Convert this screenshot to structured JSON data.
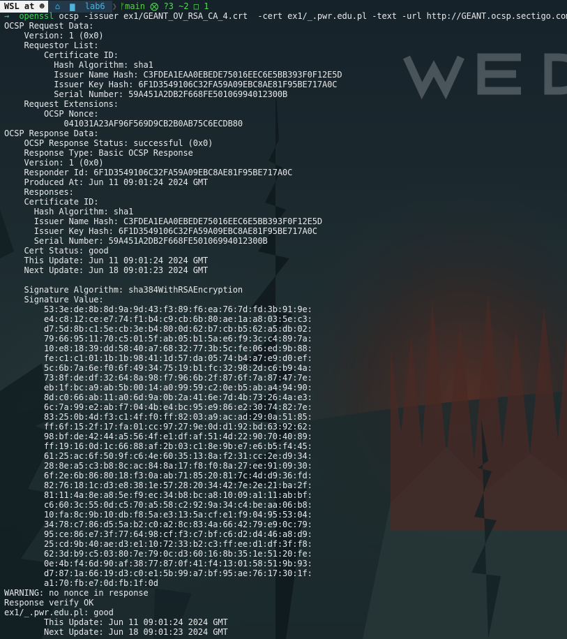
{
  "prompt": {
    "host": "WSL at",
    "host_icon": "os-logo-icon",
    "home_icon": "home-icon",
    "folder_icon": "folder-icon",
    "directory": "lab6",
    "branch_icon": "git-branch-icon",
    "branch": "main",
    "git_status": "⨂ ?3 ~2 □ 1",
    "separator": "❯"
  },
  "command": {
    "arrow": "→",
    "program": "openssl",
    "args": " ocsp -issuer ex1/GEANT_OV_RSA_CA_4.crt  -cert ex1/_.pwr.edu.pl -text -url http://GEANT.ocsp.sectigo.com"
  },
  "output_lines": [
    "OCSP Request Data:",
    "    Version: 1 (0x0)",
    "    Requestor List:",
    "        Certificate ID:",
    "          Hash Algorithm: sha1",
    "          Issuer Name Hash: C3FDEA1EAA0EBEDE75016EEC6E5BB393F0F12E5D",
    "          Issuer Key Hash: 6F1D3549106C32FA59A09EBC8AE81F95BE717A0C",
    "          Serial Number: 59A451A2DB2F668FE50106994012300B",
    "    Request Extensions:",
    "        OCSP Nonce:",
    "            041031A23AF96F569D9CB2B0AB75C6ECDB80",
    "OCSP Response Data:",
    "    OCSP Response Status: successful (0x0)",
    "    Response Type: Basic OCSP Response",
    "    Version: 1 (0x0)",
    "    Responder Id: 6F1D3549106C32FA59A09EBC8AE81F95BE717A0C",
    "    Produced At: Jun 11 09:01:24 2024 GMT",
    "    Responses:",
    "    Certificate ID:",
    "      Hash Algorithm: sha1",
    "      Issuer Name Hash: C3FDEA1EAA0EBEDE75016EEC6E5BB393F0F12E5D",
    "      Issuer Key Hash: 6F1D3549106C32FA59A09EBC8AE81F95BE717A0C",
    "      Serial Number: 59A451A2DB2F668FE50106994012300B",
    "    Cert Status: good",
    "    This Update: Jun 11 09:01:24 2024 GMT",
    "    Next Update: Jun 18 09:01:23 2024 GMT",
    "",
    "    Signature Algorithm: sha384WithRSAEncryption",
    "    Signature Value:",
    "        53:3e:de:8b:8d:9a:9d:43:f3:89:f6:ea:76:7d:fd:3b:91:9e:",
    "        e4:c8:12:ce:e7:74:f1:b4:c9:cb:6b:80:ae:1a:a8:03:5e:c3:",
    "        d7:5d:8b:c1:5e:cb:3e:b4:80:0d:62:b7:cb:b5:62:a5:db:02:",
    "        79:66:95:11:70:c5:01:5f:ab:05:b1:5a:e6:f9:3c:c4:89:7a:",
    "        10:e8:18:39:dd:58:40:a7:68:32:77:3b:5c:fe:06:ed:9b:88:",
    "        fe:c1:c1:01:1b:1b:98:41:1d:57:da:05:74:b4:a7:e9:d0:ef:",
    "        5c:6b:7a:6e:f0:6f:49:34:75:19:b1:fc:32:98:2d:c6:b9:4a:",
    "        73:8f:de:df:32:64:8a:98:f7:96:6b:2f:87:6f:7a:87:47:7e:",
    "        eb:1f:bc:a9:ab:5b:00:14:a0:99:59:c2:0e:b5:ab:a4:94:90:",
    "        8d:c0:66:ab:11:a0:6d:9a:0b:2a:41:6e:7d:4b:73:26:4a:e3:",
    "        6c:7a:99:e2:ab:f7:04:4b:e4:bc:95:e9:86:e2:30:74:82:7e:",
    "        83:25:0b:4d:f3:c1:4f:f0:ff:82:03:a9:ac:ad:29:0a:51:85:",
    "        ff:6f:15:2f:17:fa:01:cc:97:27:9e:0d:d1:92:bd:63:92:62:",
    "        98:bf:de:42:44:a5:56:4f:e1:df:af:51:4d:22:90:70:40:89:",
    "        ff:19:16:0d:1c:66:88:af:2b:03:c1:8e:9b:e7:e6:b5:f4:45:",
    "        61:25:ac:6f:50:9f:c6:4e:60:35:13:8a:f2:31:cc:2e:d9:34:",
    "        28:8e:a5:c3:b8:8c:ac:84:8a:17:f8:f0:8a:27:ee:91:09:30:",
    "        6f:2e:6b:86:80:18:f3:0a:ab:71:85:20:81:7c:4d:d9:36:fd:",
    "        82:76:18:1c:d3:e8:38:1e:57:28:20:34:42:7e:2e:21:ba:2f:",
    "        81:11:4a:8e:a8:5e:f9:ec:34:b8:bc:a8:10:09:a1:11:ab:bf:",
    "        c6:60:3c:55:0d:c5:70:a5:58:c2:92:9a:34:c4:be:aa:06:b8:",
    "        10:fa:8c:9b:10:db:f8:5a:e3:13:5a:cf:e1:f9:04:95:53:04:",
    "        34:78:c7:86:d5:5a:b2:c0:a2:8c:83:4a:66:42:79:e9:0c:79:",
    "        95:ce:86:e7:3f:77:64:98:cf:f3:c7:bf:c6:d2:d4:46:a8:d9:",
    "        25:cd:9b:40:ae:d3:e1:10:72:33:b2:c3:ff:ee:d1:df:3f:f8:",
    "        62:3d:b9:c5:03:80:7e:79:0c:d3:60:16:8b:35:1e:51:20:fe:",
    "        0e:4b:f4:6d:90:af:38:77:87:0f:41:f4:13:01:58:51:9b:93:",
    "        d7:87:1a:66:19:d3:c0:e1:5b:99:a7:bf:95:ae:76:17:30:1f:",
    "        a1:70:fb:e7:0d:fb:1f:0d",
    "WARNING: no nonce in response",
    "Response verify OK",
    "ex1/_.pwr.edu.pl: good",
    "        This Update: Jun 11 09:01:24 2024 GMT",
    "        Next Update: Jun 18 09:01:23 2024 GMT"
  ],
  "wallpaper": {
    "logo_text": "WED",
    "colors": {
      "sky": "#17232a",
      "fog": "#3a4a4c",
      "forest_dark": "#0f1a1f",
      "accent_red": "#8a3a2c",
      "prompt_green": "#3fcf5a"
    }
  }
}
